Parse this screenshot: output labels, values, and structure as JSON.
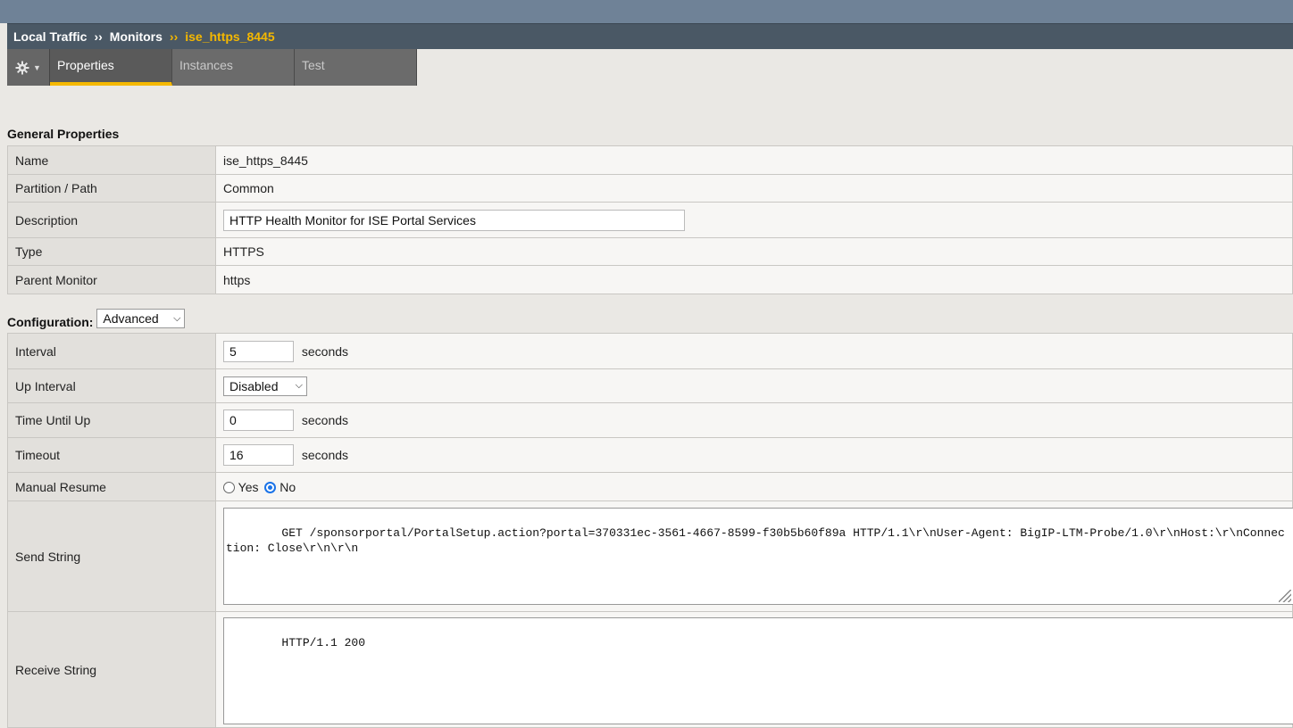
{
  "breadcrumb": {
    "items": [
      "Local Traffic",
      "Monitors"
    ],
    "separator": "››",
    "current": "ise_https_8445"
  },
  "tabs": [
    {
      "label": "Properties",
      "active": true
    },
    {
      "label": "Instances",
      "active": false
    },
    {
      "label": "Test",
      "active": false
    }
  ],
  "general": {
    "title": "General Properties",
    "name_label": "Name",
    "name_value": "ise_https_8445",
    "partition_label": "Partition / Path",
    "partition_value": "Common",
    "description_label": "Description",
    "description_value": "HTTP Health Monitor for ISE Portal Services",
    "type_label": "Type",
    "type_value": "HTTPS",
    "parent_label": "Parent Monitor",
    "parent_value": "https"
  },
  "configuration": {
    "title": "Configuration:",
    "mode": "Advanced",
    "interval_label": "Interval",
    "interval_value": "5",
    "up_interval_label": "Up Interval",
    "up_interval_value": "Disabled",
    "time_until_up_label": "Time Until Up",
    "time_until_up_value": "0",
    "timeout_label": "Timeout",
    "timeout_value": "16",
    "seconds_unit": "seconds",
    "manual_resume_label": "Manual Resume",
    "manual_resume_yes": "Yes",
    "manual_resume_no": "No",
    "manual_resume_selected": "No",
    "send_string_label": "Send String",
    "send_string_value": "GET /sponsorportal/PortalSetup.action?portal=370331ec-3561-4667-8599-f30b5b60f89a HTTP/1.1\\r\\nUser-Agent: BigIP-LTM-Probe/1.0\\r\\nHost:\\r\\nConnection: Close\\r\\n\\r\\n",
    "receive_string_label": "Receive String",
    "receive_string_value": "HTTP/1.1 200"
  },
  "colors": {
    "accent": "#f5b800",
    "header_bg": "#4a5865",
    "radio_selected": "#1a73e8"
  }
}
